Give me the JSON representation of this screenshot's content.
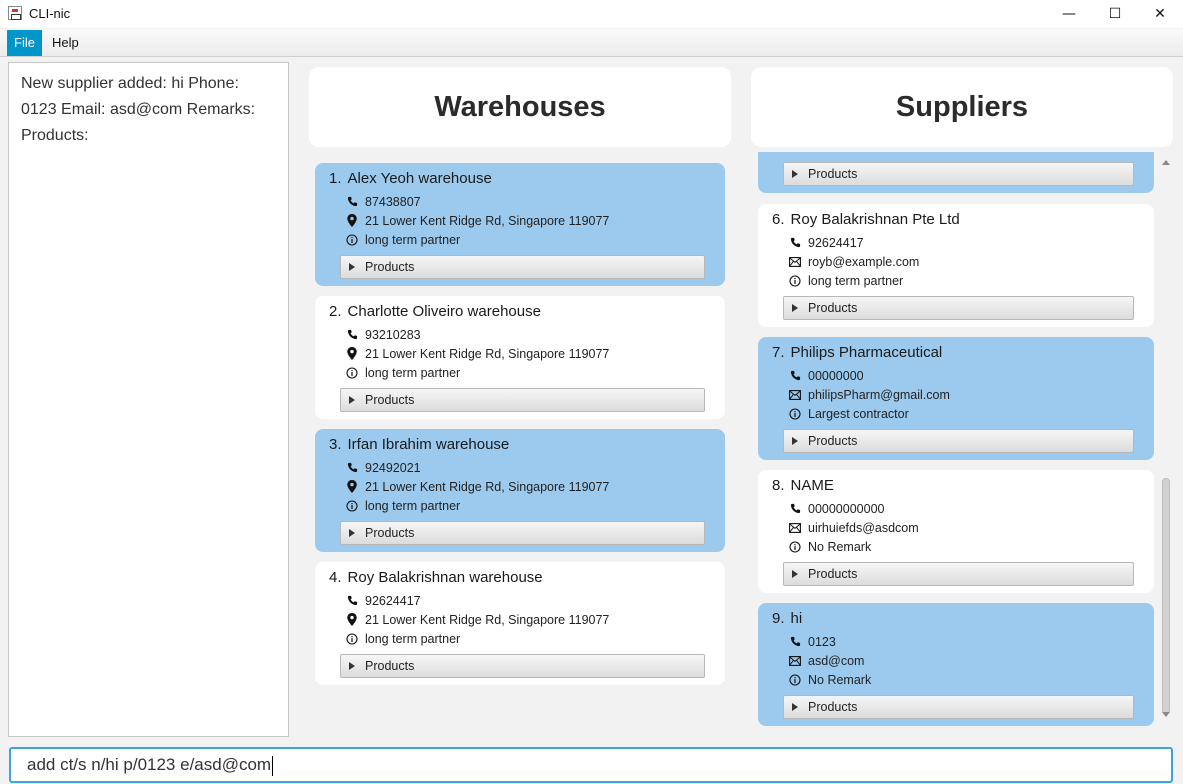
{
  "window": {
    "title": "CLI-nic",
    "controls": {
      "minimize": "—",
      "maximize": "☐",
      "close": "✕"
    }
  },
  "menu": {
    "items": [
      "File",
      "Help"
    ],
    "active": "File"
  },
  "result_display": {
    "text": "New supplier added: hi Phone: 0123 Email: asd@com Remarks: Products:"
  },
  "warehouses": {
    "header": "Warehouses",
    "items": [
      {
        "index": "1.",
        "name": "Alex Yeoh warehouse",
        "phone": "87438807",
        "address": "21 Lower Kent Ridge Rd, Singapore 119077",
        "remark": "long term partner",
        "products_label": "Products",
        "highlighted": true
      },
      {
        "index": "2.",
        "name": "Charlotte Oliveiro warehouse",
        "phone": "93210283",
        "address": "21 Lower Kent Ridge Rd, Singapore 119077",
        "remark": "long term partner",
        "products_label": "Products",
        "highlighted": false
      },
      {
        "index": "3.",
        "name": "Irfan Ibrahim warehouse",
        "phone": "92492021",
        "address": "21 Lower Kent Ridge Rd, Singapore 119077",
        "remark": "long term partner",
        "products_label": "Products",
        "highlighted": true
      },
      {
        "index": "4.",
        "name": "Roy Balakrishnan warehouse",
        "phone": "92624417",
        "address": "21 Lower Kent Ridge Rd, Singapore 119077",
        "remark": "long term partner",
        "products_label": "Products",
        "highlighted": false
      }
    ]
  },
  "suppliers": {
    "header": "Suppliers",
    "partial_item": {
      "products_label": "Products"
    },
    "items": [
      {
        "index": "6.",
        "name": "Roy Balakrishnan Pte Ltd",
        "phone": "92624417",
        "email": "royb@example.com",
        "remark": "long term partner",
        "products_label": "Products",
        "highlighted": false
      },
      {
        "index": "7.",
        "name": "Philips Pharmaceutical",
        "phone": "00000000",
        "email": "philipsPharm@gmail.com",
        "remark": "Largest contractor",
        "products_label": "Products",
        "highlighted": true
      },
      {
        "index": "8.",
        "name": "NAME",
        "phone": "00000000000",
        "email": "uirhuiefds@asdcom",
        "remark": "No Remark",
        "products_label": "Products",
        "highlighted": false
      },
      {
        "index": "9.",
        "name": "hi",
        "phone": "0123",
        "email": "asd@com",
        "remark": "No Remark",
        "products_label": "Products",
        "highlighted": true
      }
    ]
  },
  "command_box": {
    "value": "add ct/s n/hi p/0123 e/asd@com"
  },
  "icons": {
    "phone": "phone-icon",
    "address": "location-pin-icon",
    "email": "mail-icon",
    "remark": "info-icon",
    "expand": "triangle-right-icon"
  },
  "colors": {
    "highlight_card": "#9ccaef",
    "menu_active": "#0096c9",
    "command_border": "#3fa3dc"
  }
}
